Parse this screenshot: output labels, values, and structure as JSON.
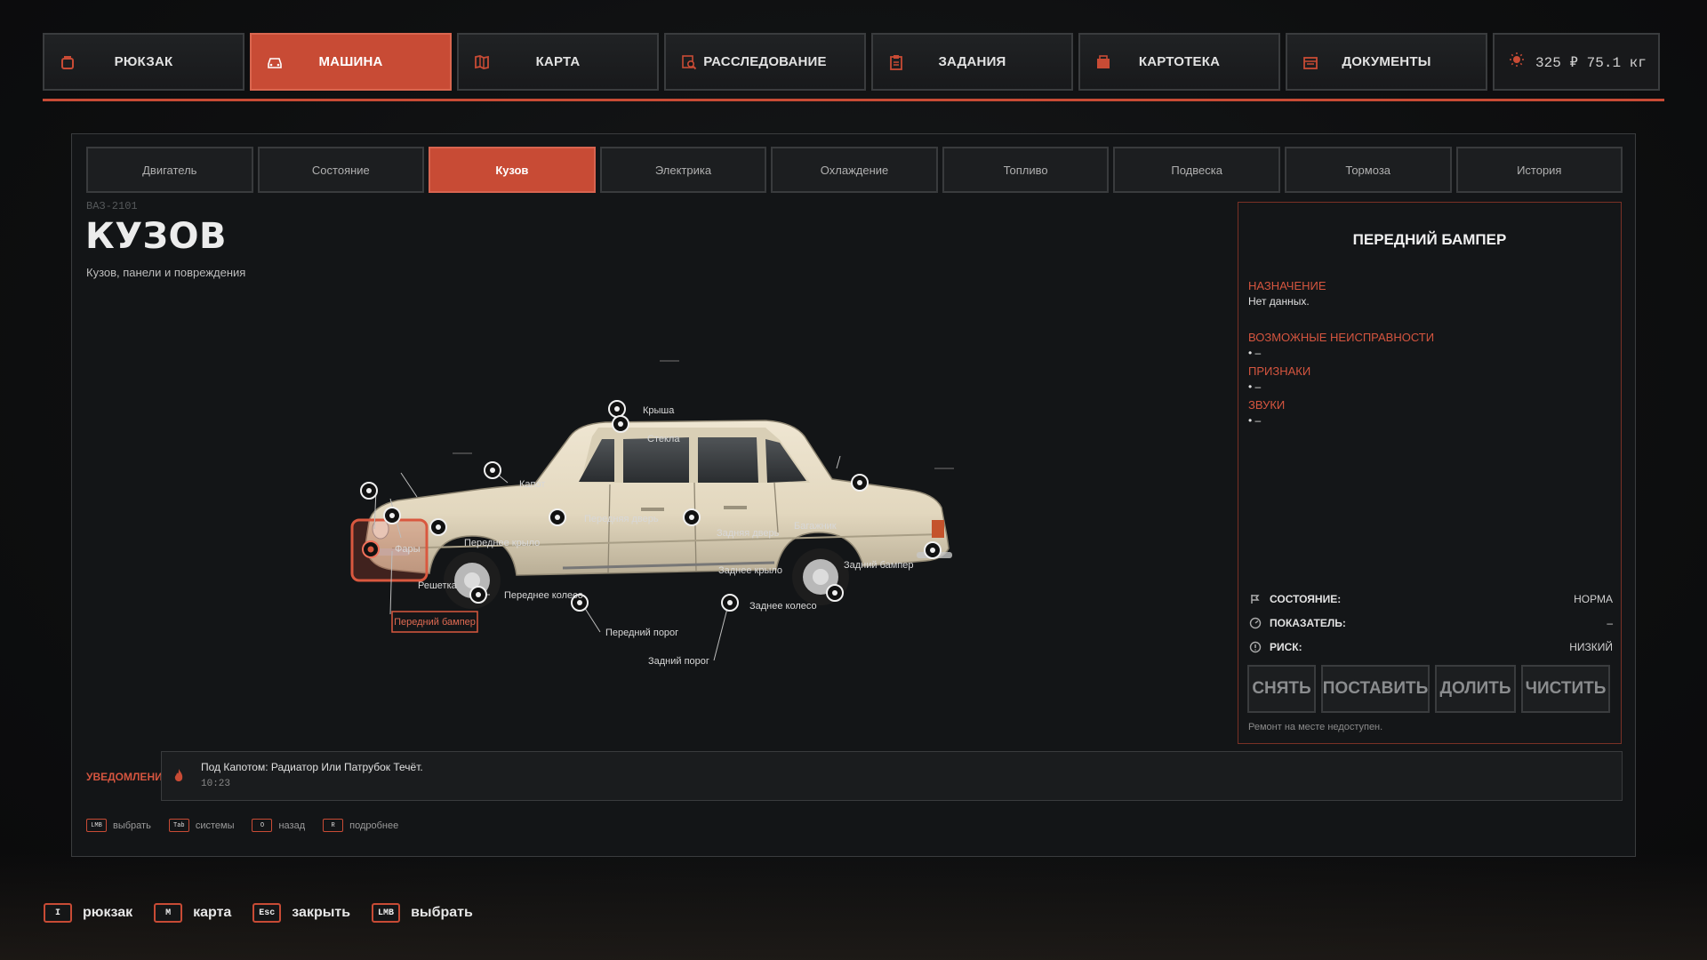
{
  "topnav": {
    "tabs": [
      {
        "label": "РЮКЗАК",
        "icon": "backpack-icon",
        "active": false
      },
      {
        "label": "МАШИНА",
        "icon": "car-icon",
        "active": true
      },
      {
        "label": "КАРТА",
        "icon": "map-icon",
        "active": false
      },
      {
        "label": "РАССЛЕДОВАНИЕ",
        "icon": "investigation-icon",
        "active": false
      },
      {
        "label": "ЗАДАНИЯ",
        "icon": "clipboard-icon",
        "active": false
      },
      {
        "label": "КАРТОТЕКА",
        "icon": "card-file-icon",
        "active": false
      },
      {
        "label": "ДОКУМЕНТЫ",
        "icon": "documents-icon",
        "active": false
      }
    ],
    "status": {
      "icon": "sun-icon",
      "text": "325 ₽ 75.1 кг"
    }
  },
  "colors": {
    "accent": "#c84b35",
    "panel_bg": "#131517",
    "border": "#3a3c3e"
  },
  "subtabs": [
    "Двигатель",
    "Состояние",
    "Кузов",
    "Электрика",
    "Охлаждение",
    "Топливо",
    "Подвеска",
    "Тормоза",
    "История"
  ],
  "subtab_active": "Кузов",
  "header": {
    "model": "ВАЗ-2101",
    "title": "КУЗОВ",
    "subtitle": "Кузов, панели и повреждения"
  },
  "diagram": {
    "labels": {
      "roof": "Крыша",
      "glass": "Стекла",
      "hood": "Капот",
      "front_door": "Передняя дверь",
      "rear_door": "Задняя дверь",
      "trunk": "Багажник",
      "headlight": "Фары",
      "front_fender": "Переднее крыло",
      "grille": "Решетка",
      "front_wheel": "Переднее колесо",
      "rear_fender": "Заднее крыло",
      "rear_bumper": "Задний бампер",
      "rear_wheel": "Заднее колесо",
      "front_sill": "Передний порог",
      "rear_sill": "Задний порог",
      "front_bumper": "Передний бампер"
    },
    "selected": "Передний бампер"
  },
  "info": {
    "title": "ПЕРЕДНИЙ БАМПЕР",
    "purpose_label": "НАЗНАЧЕНИЕ",
    "purpose_value": "Нет данных.",
    "faults_label": "ВОЗМОЖНЫЕ НЕИСПРАВНОСТИ",
    "faults_value": "• –",
    "signs_label": "ПРИЗНАКИ",
    "signs_value": "• –",
    "sounds_label": "ЗВУКИ",
    "sounds_value": "• –",
    "state_label": "СОСТОЯНИЕ:",
    "state_value": "НОРМА",
    "indicator_label": "ПОКАЗАТЕЛЬ:",
    "indicator_value": "–",
    "risk_label": "РИСК:",
    "risk_value": "НИЗКИЙ",
    "buttons": [
      "СНЯТЬ",
      "ПОСТАВИТЬ",
      "ДОЛИТЬ",
      "ЧИСТИТЬ"
    ],
    "note": "Ремонт на месте недоступен."
  },
  "notifications": {
    "label": "УВЕДОМЛЕНИЯ",
    "text": "Под Капотом: Радиатор Или Патрубок Течёт.",
    "time": "10:23"
  },
  "panel_hints": [
    {
      "key": "LMB",
      "label": "выбрать"
    },
    {
      "key": "Tab",
      "label": "системы"
    },
    {
      "key": "O",
      "label": "назад"
    },
    {
      "key": "R",
      "label": "подробнее"
    }
  ],
  "bottom_hints": [
    {
      "key": "I",
      "label": "рюкзак"
    },
    {
      "key": "M",
      "label": "карта"
    },
    {
      "key": "Esc",
      "label": "закрыть"
    },
    {
      "key": "LMB",
      "label": "выбрать"
    }
  ]
}
